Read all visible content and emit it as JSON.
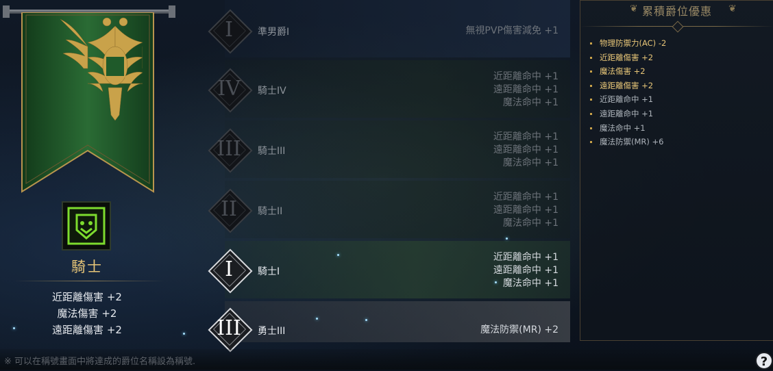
{
  "left_panel": {
    "class_name": "騎士",
    "bonuses": [
      "近距離傷害 +2",
      "魔法傷害 +2",
      "遠距離傷害 +2"
    ]
  },
  "ranks": [
    {
      "numeral": "I",
      "name": "準男爵I",
      "bonuses": [
        "無視PVP傷害減免 +1"
      ],
      "state": "locked"
    },
    {
      "numeral": "IV",
      "name": "騎士IV",
      "bonuses": [
        "近距離命中 +1",
        "遠距離命中 +1",
        "魔法命中 +1"
      ],
      "state": "locked"
    },
    {
      "numeral": "III",
      "name": "騎士III",
      "bonuses": [
        "近距離命中 +1",
        "遠距離命中 +1",
        "魔法命中 +1"
      ],
      "state": "locked"
    },
    {
      "numeral": "II",
      "name": "騎士II",
      "bonuses": [
        "近距離命中 +1",
        "遠距離命中 +1",
        "魔法命中 +1"
      ],
      "state": "locked"
    },
    {
      "numeral": "I",
      "name": "騎士I",
      "bonuses": [
        "近距離命中 +1",
        "遠距離命中 +1",
        "魔法命中 +1"
      ],
      "state": "current"
    },
    {
      "numeral": "III",
      "name": "勇士III",
      "bonuses": [
        "魔法防禦(MR) +2"
      ],
      "state": "achieved"
    }
  ],
  "right_panel": {
    "title": "累積爵位優惠",
    "items": [
      {
        "text": "物理防禦力(AC) -2",
        "highlight": true
      },
      {
        "text": "近距離傷害 +2",
        "highlight": true
      },
      {
        "text": "魔法傷害 +2",
        "highlight": true
      },
      {
        "text": "遠距離傷害 +2",
        "highlight": true
      },
      {
        "text": "近距離命中 +1",
        "highlight": false
      },
      {
        "text": "遠距離命中 +1",
        "highlight": false
      },
      {
        "text": "魔法命中 +1",
        "highlight": false
      },
      {
        "text": "魔法防禦(MR) +6",
        "highlight": false
      }
    ]
  },
  "footer": {
    "note": "※ 可以在稱號畫面中將達成的爵位名稱設為稱號.",
    "help_label": "?"
  },
  "colors": {
    "gold": "#e8c678",
    "banner_green": "#1f5a2a",
    "badge_green": "#7ddc2e"
  }
}
